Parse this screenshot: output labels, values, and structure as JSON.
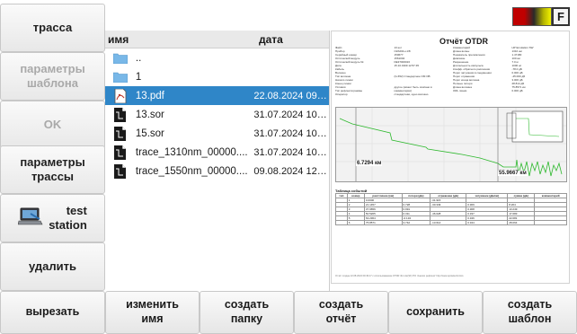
{
  "sidebar": {
    "trace": "трасса",
    "template_params": "параметры\nшаблона",
    "ok": "OK",
    "trace_params": "параметры\nтрассы",
    "test_station": "test\nstation",
    "delete": "удалить"
  },
  "topbar": {
    "f_label": "F",
    "indicator_colors": [
      "#c00000",
      "#2a2a2a",
      "#f2f200"
    ]
  },
  "filelist": {
    "col_name": "имя",
    "col_date": "дата",
    "rows": [
      {
        "name": "..",
        "date": "",
        "icon": "folder-icon"
      },
      {
        "name": "1",
        "date": "",
        "icon": "folder-icon"
      },
      {
        "name": "13.pdf",
        "date": "22.08.2024 09:49...",
        "icon": "pdf-icon",
        "selected": true
      },
      {
        "name": "13.sor",
        "date": "31.07.2024 10:01...",
        "icon": "sor-file-icon"
      },
      {
        "name": "15.sor",
        "date": "31.07.2024 10:01...",
        "icon": "sor-file-icon"
      },
      {
        "name": "trace_1310nm_00000....",
        "date": "31.07.2024 10:03...",
        "icon": "sor-file-icon"
      },
      {
        "name": "trace_1550nm_00000....",
        "date": "09.08.2024 12:37...",
        "icon": "sor-file-icon"
      }
    ]
  },
  "report": {
    "title": "Отчёт OTDR",
    "meta_left": [
      "Файл",
      "Прибор",
      "Серийный номер",
      "Оптический модуль",
      "Оптический модуль №",
      "Дата",
      "Кабель",
      "Волокно",
      "Тип волокна",
      "Начало линии",
      "Конец линии",
      "Условия",
      "Тип рефлектограммы",
      "Оператор"
    ],
    "meta_mid": [
      "13.sor",
      "OZARIA-L1/8",
      "150677",
      "1561004",
      "DE37000016",
      "15.10.1999 12:57:45",
      "",
      "",
      "(G.652) Стандартное ОМ ОВ",
      "",
      "",
      "другое (может быть описано в комментарии)",
      "стандартная, одно волокно",
      ""
    ],
    "meta_right": [
      "Комментарий",
      "Длина волны",
      "Показатель преломления",
      "Диапазон",
      "Разрешение",
      "Длительность импульса",
      "Коэфф. обратного рассеяния",
      "Порог затухания в соединении",
      "Порог отражения",
      "Порог конца волокна",
      "Полные потери",
      "Длина волокна",
      "ORL линии"
    ],
    "meta_values": [
      "HP Emulation SW",
      "1310 нм",
      "1.47180",
      "100 км",
      "7.0 м",
      "1000 нс",
      "-78.0 дБ",
      "0.000 дБ",
      "-45.000 дБ",
      "3.000 дБ",
      "28.814 дБ",
      "75.8571 км",
      "0.000 дБ"
    ],
    "km_a": "6.7294 км",
    "km_b": "55.9667 км",
    "events_title": "Таблица событий",
    "events_headers": [
      "тип",
      "номер",
      "расстояние (км)",
      "потери (дБ)",
      "отражение (дБ)",
      "затухание (дБ/км)",
      "сумма (дБ)",
      "комментарий"
    ],
    "events_rows": [
      [
        "",
        "1",
        "0.0000",
        "",
        "-31.915",
        "",
        "",
        ""
      ],
      [
        "",
        "2",
        "21.1457",
        "0.728",
        "-30.349",
        "0.309",
        "8.204",
        ""
      ],
      [
        "",
        "3",
        "37.9656",
        "0.991",
        "",
        "0.308",
        "13.249",
        ""
      ],
      [
        "",
        "4",
        "50.5205",
        "0.311",
        "-46.028",
        "0.337",
        "17.683",
        ""
      ],
      [
        "",
        "5",
        "63.2364",
        "-0.134",
        "",
        "0.346",
        "22.081",
        ""
      ],
      [
        "",
        "6",
        "75.8571",
        "3.742",
        "-13.614",
        "0.344",
        "28.064",
        ""
      ]
    ],
    "footer": "Отчёт создан 22.08.2024 09:49:17 с использованием OTDR 4G Lite(SF) ПО 'Анализ рефлекс' http://www.optoelectronics"
  },
  "bottombar": {
    "cut": "вырезать",
    "rename": "изменить\nимя",
    "new_folder": "создать\nпапку",
    "create_report": "создать\nотчёт",
    "save": "сохранить",
    "create_template": "создать\nшаблон"
  }
}
